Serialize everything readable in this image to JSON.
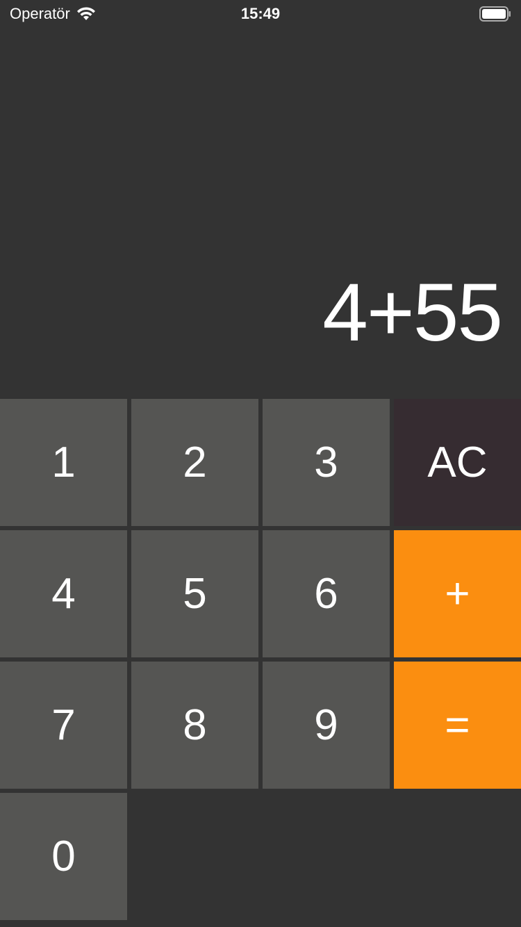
{
  "status_bar": {
    "carrier": "Operatör",
    "time": "15:49",
    "wifi_icon": "wifi-icon",
    "battery_icon": "battery-icon"
  },
  "display": {
    "expression": "4+55"
  },
  "keys": {
    "one": "1",
    "two": "2",
    "three": "3",
    "clear": "AC",
    "four": "4",
    "five": "5",
    "six": "6",
    "plus": "+",
    "seven": "7",
    "eight": "8",
    "nine": "9",
    "equals": "=",
    "zero": "0"
  },
  "colors": {
    "background": "#333333",
    "digit_key": "#555553",
    "clear_key": "#362c31",
    "operator_key": "#fb8e10",
    "text": "#ffffff"
  }
}
